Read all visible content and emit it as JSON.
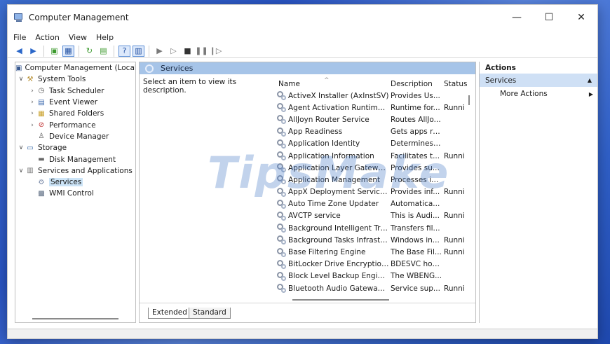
{
  "window": {
    "title": "Computer Management"
  },
  "controls": {
    "minimize": "—",
    "maximize": "☐",
    "close": "✕"
  },
  "menu": [
    "File",
    "Action",
    "View",
    "Help"
  ],
  "tree": {
    "root": "Computer Management (Local",
    "system_tools": "System Tools",
    "task_scheduler": "Task Scheduler",
    "event_viewer": "Event Viewer",
    "shared_folders": "Shared Folders",
    "performance": "Performance",
    "device_manager": "Device Manager",
    "storage": "Storage",
    "disk_management": "Disk Management",
    "services_and_applications": "Services and Applications",
    "services": "Services",
    "wmi_control": "WMI Control"
  },
  "center": {
    "header": "Services",
    "description_hint": "Select an item to view its description.",
    "columns": {
      "name": "Name",
      "description": "Description",
      "status": "Status"
    },
    "rows": [
      {
        "name": "ActiveX Installer (AxInstSV)",
        "description": "Provides Us...",
        "status": ""
      },
      {
        "name": "Agent Activation Runtime_...",
        "description": "Runtime for...",
        "status": "Runni"
      },
      {
        "name": "AllJoyn Router Service",
        "description": "Routes AllJo...",
        "status": ""
      },
      {
        "name": "App Readiness",
        "description": "Gets apps re...",
        "status": ""
      },
      {
        "name": "Application Identity",
        "description": "Determines ...",
        "status": ""
      },
      {
        "name": "Application Information",
        "description": "Facilitates t...",
        "status": "Runni"
      },
      {
        "name": "Application Layer Gateway ...",
        "description": "Provides su...",
        "status": ""
      },
      {
        "name": "Application Management",
        "description": "Processes in...",
        "status": ""
      },
      {
        "name": "AppX Deployment Service (...",
        "description": "Provides inf...",
        "status": "Runni"
      },
      {
        "name": "Auto Time Zone Updater",
        "description": "Automatica...",
        "status": ""
      },
      {
        "name": "AVCTP service",
        "description": "This is Audi...",
        "status": "Runni"
      },
      {
        "name": "Background Intelligent Tran...",
        "description": "Transfers fil...",
        "status": ""
      },
      {
        "name": "Background Tasks Infrastruc...",
        "description": "Windows in...",
        "status": "Runni"
      },
      {
        "name": "Base Filtering Engine",
        "description": "The Base Fil...",
        "status": "Runni"
      },
      {
        "name": "BitLocker Drive Encryption ...",
        "description": "BDESVC hos...",
        "status": ""
      },
      {
        "name": "Block Level Backup Engine ...",
        "description": "The WBENG...",
        "status": ""
      },
      {
        "name": "Bluetooth Audio Gateway S...",
        "description": "Service sup...",
        "status": "Runni"
      }
    ],
    "tabs": [
      "Extended",
      "Standard"
    ]
  },
  "watermark": "TipsMake",
  "actions": {
    "title": "Actions",
    "section": "Services",
    "more_actions": "More Actions"
  }
}
